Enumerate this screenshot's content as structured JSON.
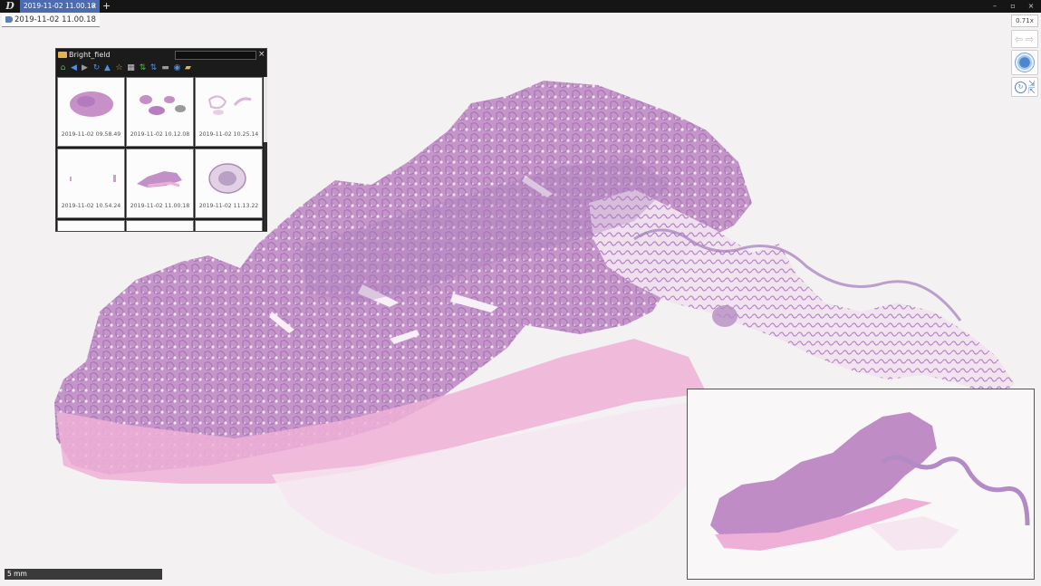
{
  "titlebar": {
    "app_icon": "d-logo-icon",
    "tab_label": "2019-11-02 11.00.18",
    "tab_close": "×",
    "new_tab": "+",
    "minimize": "–",
    "restore": "▫",
    "close": "×"
  },
  "slide": {
    "label": "2019-11-02 11.00.18"
  },
  "viewer": {
    "zoom": "0.71x",
    "nav_back": "⇦",
    "nav_forward": "⇨",
    "scale_label": "5 mm"
  },
  "browser": {
    "title": "Bright_field",
    "close": "×",
    "toolbar": [
      "home-icon",
      "back-arrow-icon",
      "forward-arrow-icon",
      "refresh-icon",
      "up-arrow-icon",
      "star-icon",
      "calendar-icon",
      "sort-asc-icon",
      "sort-desc-icon",
      "view-icon",
      "sync-icon",
      "folder-icon"
    ],
    "items": [
      {
        "label": "2019-11-02 09.58.49"
      },
      {
        "label": "2019-11-02 10.12.08"
      },
      {
        "label": "2019-11-02 10.25.14"
      },
      {
        "label": "2019-11-02 10.54.24"
      },
      {
        "label": "2019-11-02 11.00.18"
      },
      {
        "label": "2019-11-02 11.13.22"
      }
    ]
  },
  "colors": {
    "tissue": "#c896cc",
    "tissue_dark": "#9c72b0",
    "stroma": "#eeaed4",
    "tab_active": "#4c6bb0"
  }
}
